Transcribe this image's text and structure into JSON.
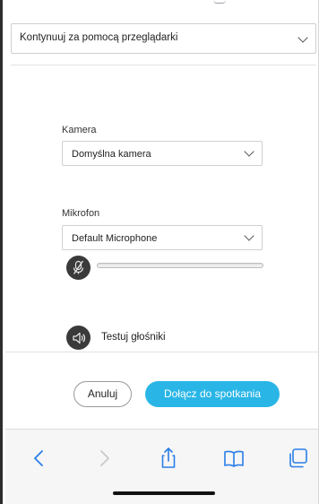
{
  "browser_prompt": {
    "selected": "Kontynuuj za pomocą przeglądarki"
  },
  "camera": {
    "label": "Kamera",
    "selected": "Domyślna kamera"
  },
  "microphone": {
    "label": "Mikrofon",
    "selected": "Default Microphone",
    "muted": true,
    "input_level": 0
  },
  "speaker": {
    "test_label": "Testuj głośniki"
  },
  "actions": {
    "cancel_label": "Anuluj",
    "join_label": "Dołącz do spotkania"
  },
  "browser_toolbar": {
    "items": [
      "back-icon",
      "forward-icon",
      "share-icon",
      "bookmarks-icon",
      "tabs-icon"
    ]
  },
  "colors": {
    "accent": "#29b6e6",
    "icon_circle": "#3a3a3a",
    "toolbar_icon": "#2a7ee8"
  }
}
